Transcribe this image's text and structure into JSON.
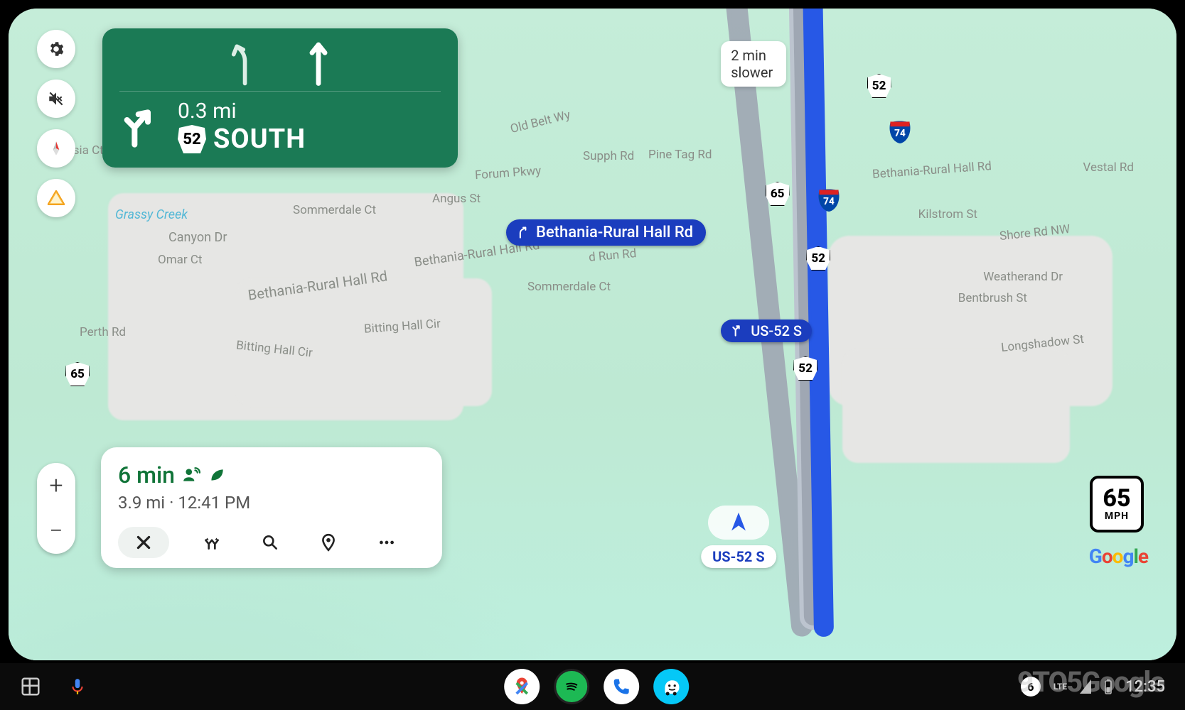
{
  "navigation_card": {
    "distance": "0.3 mi",
    "route_shield": "52",
    "direction": "SOUTH"
  },
  "alt_route_tooltip": "2 min slower",
  "route_callouts": {
    "upcoming_turn": "Bethania-Rural Hall Rd",
    "current_highway": "US-52 S"
  },
  "current_road_label": "US-52 S",
  "trip_summary": {
    "eta_duration": "6 min",
    "distance": "3.9 mi",
    "arrival_time": "12:41 PM"
  },
  "speed_limit": {
    "value": "65",
    "unit": "MPH"
  },
  "map_labels": {
    "grassy_creek": "Grassy Creek",
    "canyon_dr": "Canyon Dr",
    "omar_ct": "Omar Ct",
    "sommerdale_ct": "Sommerdale Ct",
    "sommerdale_ct2": "Sommerdale Ct",
    "bethania_rural": "Bethania-Rural Hall Rd",
    "bethania_rural2": "Bethania-Rural Hall Rd",
    "bethania_rural3": "Bethania-Rural Hall Rd",
    "hetesia_ct": "Hetesia Ct",
    "forum_pkwy": "Forum Pkwy",
    "angus_st": "Angus St",
    "old_belt_wy": "Old Belt Wy",
    "supph_rd": "Supph Rd",
    "pine_tag_rd": "Pine Tag Rd",
    "kilstrom_st": "Kilstrom St",
    "shore_rd": "Shore Rd NW",
    "vestal_rd": "Vestal Rd",
    "weatherand_dr": "Weatherand Dr",
    "bentbrush_st": "Bentbrush St",
    "longshadow_st": "Longshadow St",
    "perth_rd": "Perth Rd",
    "bitting_hall": "Bitting Hall Cir",
    "bitting_hall2": "Bitting Hall Cir",
    "d_run_rd": "d Run Rd"
  },
  "shields": {
    "us65_left": "65",
    "us65_right": "65",
    "us52_top": "52",
    "us52_mid": "52",
    "us52_lower": "52",
    "i74": "74",
    "i74b": "74"
  },
  "brand": "Google",
  "taskbar": {
    "time": "12:35",
    "net": "LTE",
    "notif_count": "6"
  },
  "watermark": "9TO5Google"
}
